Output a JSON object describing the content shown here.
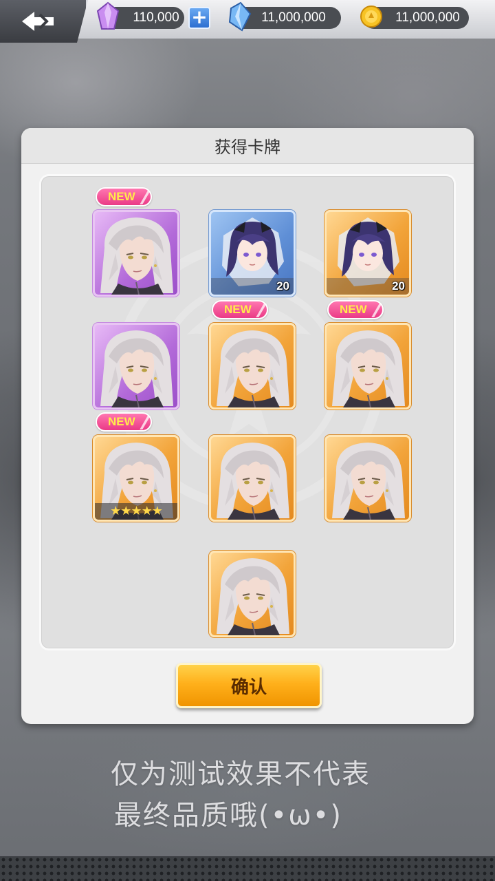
{
  "topbar": {
    "gem_amount": "110,000",
    "crystal_amount": "11,000,000",
    "coin_amount": "11,000,000",
    "icons": [
      "back-icon",
      "purple-gem-icon",
      "plus-icon",
      "blue-crystal-icon",
      "gold-coin-icon"
    ]
  },
  "dialog": {
    "title": "获得卡牌",
    "confirm_label": "确认"
  },
  "cards": [
    {
      "rarity": "purple",
      "character": "silver-hair-man",
      "badge": "NEW",
      "count": "",
      "stars": ""
    },
    {
      "rarity": "blue",
      "character": "purple-hair-girl",
      "badge": "",
      "count": "20",
      "stars": ""
    },
    {
      "rarity": "orange",
      "character": "purple-hair-girl",
      "badge": "",
      "count": "20",
      "stars": ""
    },
    {
      "rarity": "purple",
      "character": "silver-hair-man",
      "badge": "",
      "count": "",
      "stars": ""
    },
    {
      "rarity": "orange",
      "character": "silver-hair-man",
      "badge": "NEW",
      "count": "",
      "stars": ""
    },
    {
      "rarity": "orange",
      "character": "silver-hair-man",
      "badge": "NEW",
      "count": "",
      "stars": ""
    },
    {
      "rarity": "orange",
      "character": "silver-hair-man",
      "badge": "NEW",
      "count": "",
      "stars": "★★★★★"
    },
    {
      "rarity": "orange",
      "character": "silver-hair-man",
      "badge": "",
      "count": "",
      "stars": ""
    },
    {
      "rarity": "orange",
      "character": "silver-hair-man",
      "badge": "",
      "count": "",
      "stars": ""
    },
    {
      "rarity": "orange",
      "character": "silver-hair-man",
      "badge": "",
      "count": "",
      "stars": ""
    }
  ],
  "footer": {
    "line1": "仅为测试效果不代表",
    "line2": "最终品质哦(•ω•)"
  },
  "colors": {
    "purple_frame": "#b36ad9",
    "orange_frame": "#f2a43a",
    "blue_frame": "#5f8fd6",
    "new_badge": "#ea3a86",
    "confirm_button": "#ffb01b"
  }
}
